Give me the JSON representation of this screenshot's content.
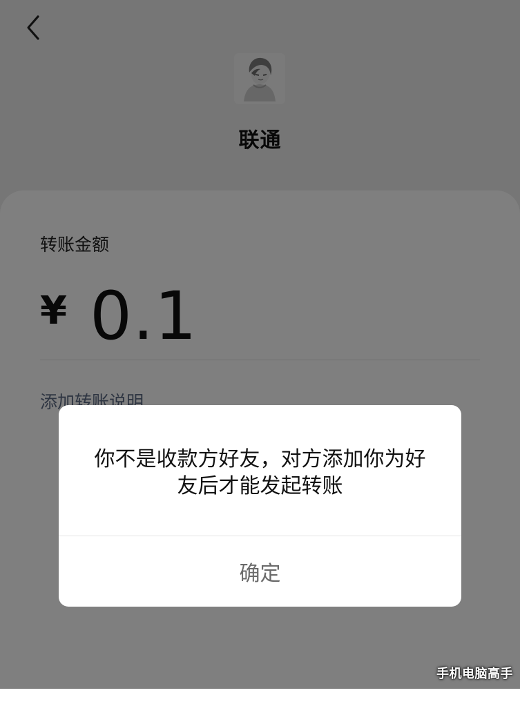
{
  "header": {
    "back_icon": "chevron-left-icon",
    "payee_name": "联通"
  },
  "transfer": {
    "amount_label": "转账金额",
    "currency_symbol": "¥",
    "amount": "0.1",
    "add_note_label": "添加转账说明"
  },
  "dialog": {
    "message": "你不是收款方好友，对方添加你为好友后才能发起转账",
    "confirm_label": "确定"
  },
  "watermark": {
    "text": "手机电脑高手"
  },
  "colors": {
    "background": "#ededed",
    "card": "#ffffff",
    "overlay": "rgba(0,0,0,0.5)",
    "link_text": "#5d6b84",
    "button_text": "#6a6a6a"
  }
}
